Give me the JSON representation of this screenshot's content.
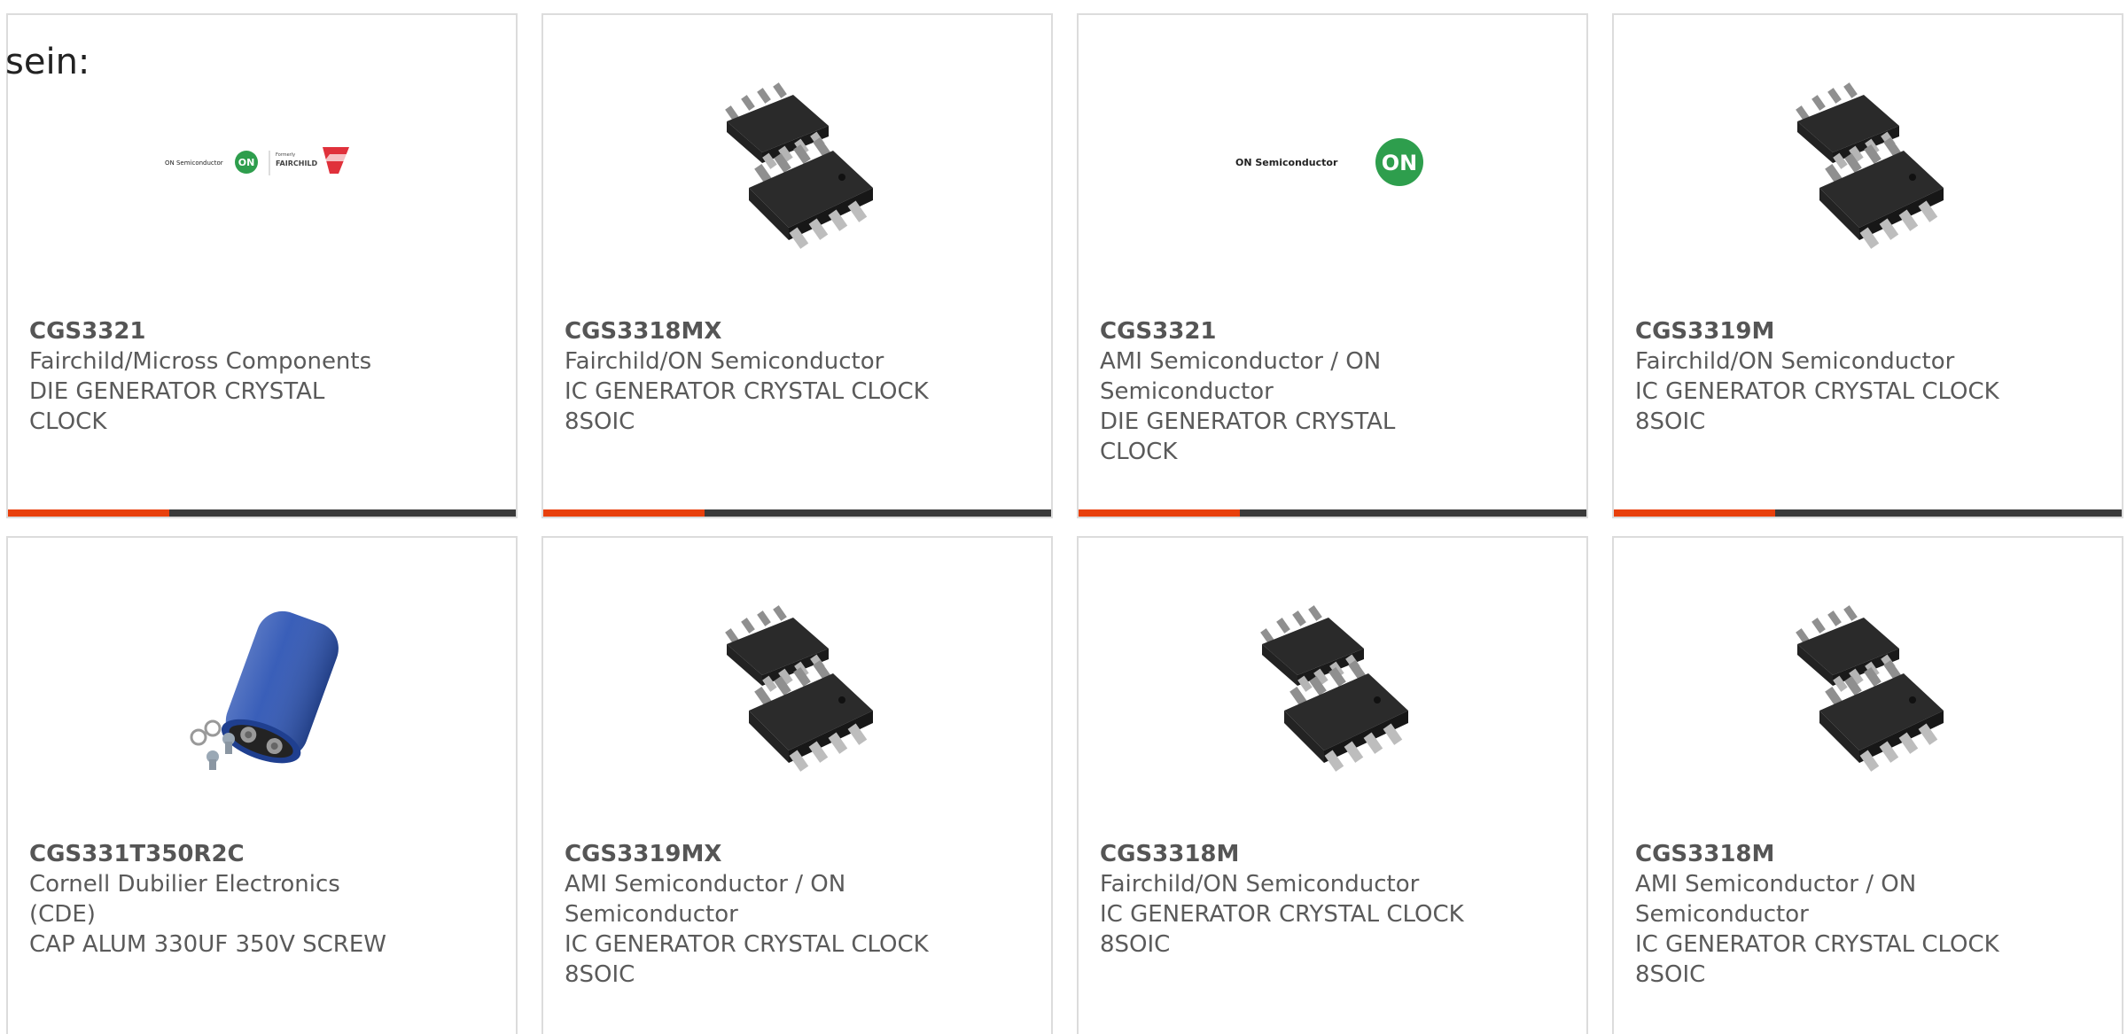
{
  "intro_text": "sein:",
  "colors": {
    "accent": "#e8400c",
    "bar_dark": "#3a3a3a",
    "card_border": "#dcdcdc",
    "text": "#5a5a5a"
  },
  "products": [
    {
      "part_number": "CGS3321",
      "manufacturer": "Fairchild/Micross Components",
      "description": "DIE GENERATOR CRYSTAL CLOCK",
      "image": "on-semiconductor-fairchild-logo"
    },
    {
      "part_number": "CGS3318MX",
      "manufacturer": "Fairchild/ON Semiconductor",
      "description": "IC GENERATOR CRYSTAL CLOCK 8SOIC",
      "image": "soic-8-chip"
    },
    {
      "part_number": "CGS3321",
      "manufacturer": "AMI Semiconductor / ON Semiconductor",
      "description": "DIE GENERATOR CRYSTAL CLOCK",
      "image": "on-semiconductor-logo"
    },
    {
      "part_number": "CGS3319M",
      "manufacturer": "Fairchild/ON Semiconductor",
      "description": "IC GENERATOR CRYSTAL CLOCK 8SOIC",
      "image": "soic-8-chip"
    },
    {
      "part_number": "CGS331T350R2C",
      "manufacturer": "Cornell Dubilier Electronics (CDE)",
      "description": "CAP ALUM 330UF 350V SCREW",
      "image": "electrolytic-capacitor"
    },
    {
      "part_number": "CGS3319MX",
      "manufacturer": "AMI Semiconductor / ON Semiconductor",
      "description": "IC GENERATOR CRYSTAL CLOCK 8SOIC",
      "image": "soic-8-chip"
    },
    {
      "part_number": "CGS3318M",
      "manufacturer": "Fairchild/ON Semiconductor",
      "description": "IC GENERATOR CRYSTAL CLOCK 8SOIC",
      "image": "soic-8-chip"
    },
    {
      "part_number": "CGS3318M",
      "manufacturer": "AMI Semiconductor / ON Semiconductor",
      "description": "IC GENERATOR CRYSTAL CLOCK 8SOIC",
      "image": "soic-8-chip"
    }
  ],
  "logo_text": {
    "on_semiconductor": "ON Semiconductor",
    "on_badge": "ON",
    "fairchild": "FAIRCHILD",
    "fairchild_prefix": "Formerly"
  }
}
